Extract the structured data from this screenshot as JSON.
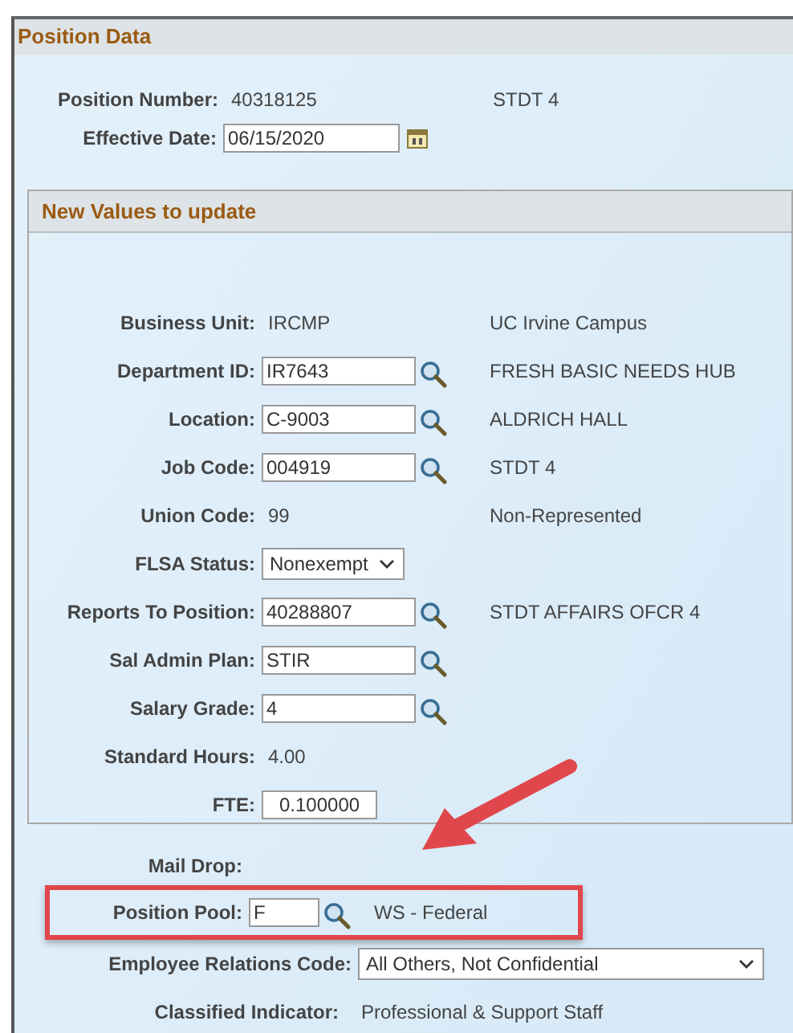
{
  "panel": {
    "title": "Position Data"
  },
  "header_rows": [
    {
      "kind": "display",
      "label": "Position Number:",
      "value": "40318125",
      "description": "STDT 4"
    },
    {
      "kind": "date",
      "label": "Effective Date:",
      "value": "06/15/2020"
    }
  ],
  "section": {
    "title": "New Values to update",
    "rows": [
      {
        "kind": "display",
        "label": "Business Unit:",
        "value": "IRCMP",
        "description": "UC Irvine Campus"
      },
      {
        "kind": "lookup",
        "label": "Department ID:",
        "value": "IR7643",
        "description": "FRESH BASIC NEEDS HUB"
      },
      {
        "kind": "lookup",
        "label": "Location:",
        "value": "C-9003",
        "description": "ALDRICH HALL"
      },
      {
        "kind": "lookup",
        "label": "Job Code:",
        "value": "004919",
        "description": "STDT 4"
      },
      {
        "kind": "display",
        "label": "Union Code:",
        "value": "99",
        "description": "Non-Represented"
      },
      {
        "kind": "select",
        "label": "FLSA Status:",
        "value": "Nonexempt"
      },
      {
        "kind": "lookup",
        "label": "Reports To Position:",
        "value": "40288807",
        "description": "STDT AFFAIRS OFCR 4"
      },
      {
        "kind": "lookup",
        "label": "Sal Admin Plan:",
        "value": "STIR"
      },
      {
        "kind": "lookup",
        "label": "Salary Grade:",
        "value": "4"
      },
      {
        "kind": "display",
        "label": "Standard Hours:",
        "value": "4.00"
      },
      {
        "kind": "input",
        "label": "FTE:",
        "value": "0.100000"
      }
    ]
  },
  "footer_rows": [
    {
      "kind": "display",
      "label": "Mail Drop:",
      "highlighted": false
    },
    {
      "kind": "lookup",
      "label": "Position Pool:",
      "value": "F",
      "description": "WS - Federal",
      "highlighted": true
    },
    {
      "kind": "select",
      "label": "Employee Relations Code:",
      "value": "All Others, Not Confidential",
      "highlighted": false
    },
    {
      "kind": "display",
      "label": "Classified Indicator:",
      "value": "Professional & Support Staff",
      "highlighted": false
    }
  ]
}
